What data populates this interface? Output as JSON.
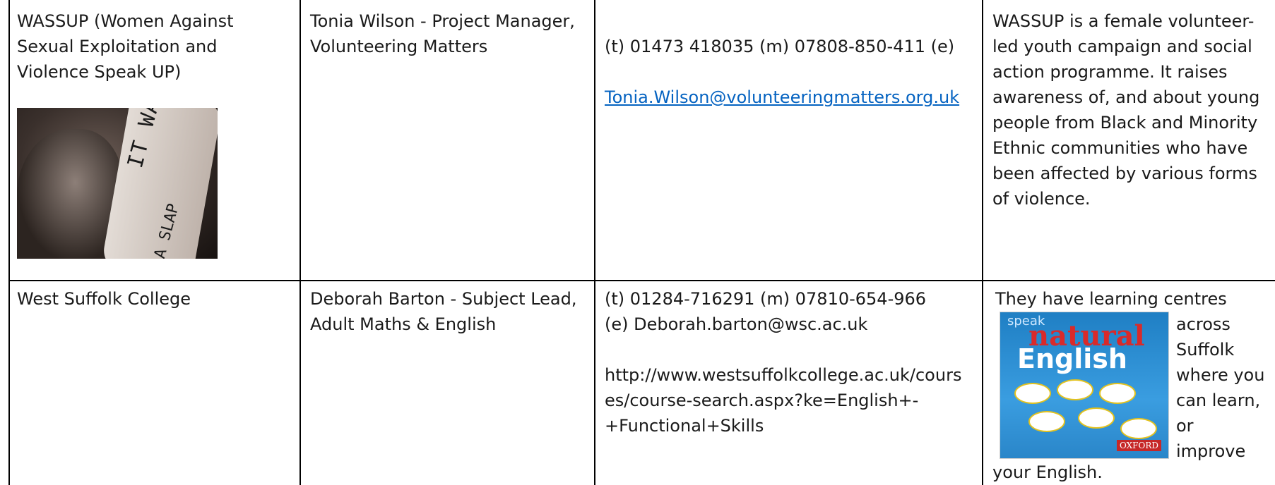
{
  "rows": [
    {
      "organisation": "WASSUP (Women Against\nSexual Exploitation and\nViolence Speak UP)",
      "contact": "Tonia Wilson - Project Manager,\nVolunteering Matters",
      "details_text": "(t) 01473 418035 (m) 07808-850-411 (e)",
      "details_email": "Tonia.Wilson@volunteeringmatters.org.uk",
      "description": "WASSUP is a female volunteer-\nled youth campaign and social\naction programme. It raises\nawareness of, and about young\npeople from Black and Minority\nEthnic communities who have\nbeen affected by various forms\nof violence.",
      "image_text_1": "IT WAS 'ONLY'",
      "image_text_2": "A SLAP"
    },
    {
      "organisation": "West Suffolk College",
      "contact": "Deborah Barton - Subject Lead,\nAdult Maths & English",
      "details_text": "(t) 01284-716291 (m) 07810-654-966\n(e) Deborah.barton@wsc.ac.uk\n\nhttp://www.westsuffolkcollege.ac.uk/cours\nes/course-search.aspx?ke=English+-\n+Functional+Skills",
      "description_top": "They have learning centres",
      "description_side": "across\nSuffolk\nwhere you\ncan learn,\nor\nimprove",
      "description_bottom": "your English.",
      "book_speak": "speak",
      "book_natural": "natural",
      "book_english": "English",
      "book_brand": "OXFORD"
    }
  ]
}
